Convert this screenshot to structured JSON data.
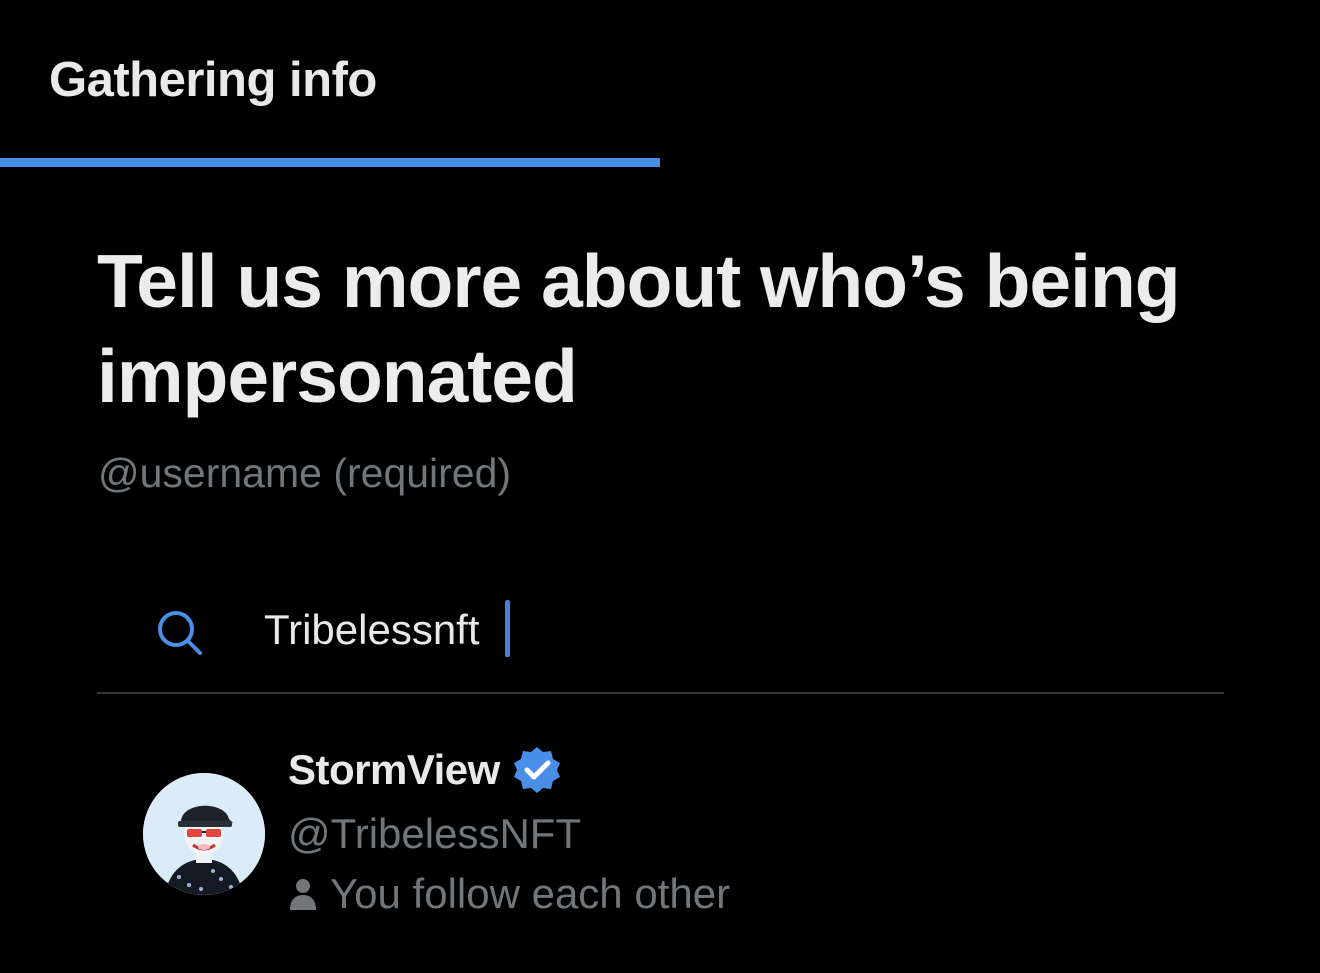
{
  "header": {
    "title": "Gathering info"
  },
  "progress": {
    "fraction": 0.5,
    "color": "#4a8fe7"
  },
  "form": {
    "heading": "Tell us more about who’s being impersonated",
    "username_label": "@username (required)",
    "search": {
      "value": "Tribelessnft",
      "icon": "search-icon",
      "accent": "#4a8fe7"
    }
  },
  "result": {
    "display_name": "StormView",
    "verified": true,
    "verified_icon": "verified-badge-icon",
    "verified_color": "#4a8fe7",
    "handle": "@TribelessNFT",
    "relationship": "You follow each other",
    "relationship_icon": "person-icon"
  }
}
